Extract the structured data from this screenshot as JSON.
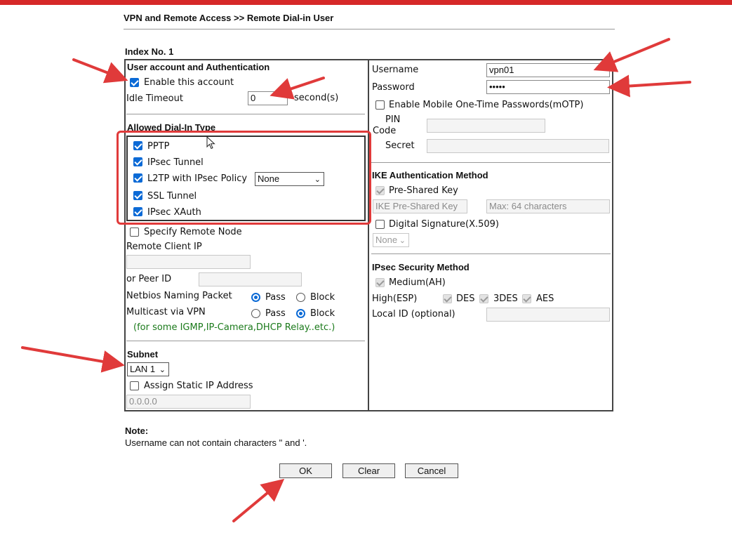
{
  "page": {
    "title": "VPN and Remote Access >> Remote Dial-in User",
    "index": "Index No. 1"
  },
  "left": {
    "section_title": "User account and Authentication",
    "enable_label": "Enable this account",
    "enable_checked": true,
    "idle_label": "Idle Timeout",
    "idle_value": "0",
    "idle_unit": "second(s)",
    "dialin_title": "Allowed Dial-In Type",
    "dialin_types": [
      {
        "label": "PPTP",
        "checked": true
      },
      {
        "label": "IPsec Tunnel",
        "checked": true
      },
      {
        "label": "L2TP with IPsec Policy",
        "checked": true
      },
      {
        "label": "SSL Tunnel",
        "checked": true
      },
      {
        "label": "IPsec XAuth",
        "checked": true
      }
    ],
    "l2tp_policy": "None",
    "specify_remote_label": "Specify Remote Node",
    "remote_client_ip_label": "Remote Client IP",
    "peer_id_label": "or Peer ID",
    "netbios_label": "Netbios Naming Packet",
    "multicast_label": "Multicast via VPN",
    "pass_label": "Pass",
    "block_label": "Block",
    "netbios_value": "Pass",
    "multicast_value": "Block",
    "multicast_note": "(for some IGMP,IP-Camera,DHCP Relay..etc.)",
    "subnet_title": "Subnet",
    "subnet_value": "LAN 1",
    "assign_static_label": "Assign Static IP Address",
    "static_ip_value": "0.0.0.0"
  },
  "right": {
    "username_label": "Username",
    "username_value": "vpn01",
    "password_label": "Password",
    "password_value": "•••••",
    "motp_label": "Enable Mobile One-Time Passwords(mOTP)",
    "pin_label_1": "PIN",
    "pin_label_2": "Code",
    "secret_label": "Secret",
    "ike_title": "IKE Authentication Method",
    "preshared_label": "Pre-Shared Key",
    "ike_key_placeholder": "IKE Pre-Shared Key",
    "max_chars_placeholder": "Max: 64 characters",
    "digital_sig_label": "Digital Signature(X.509)",
    "digital_sig_value": "None",
    "ipsec_title": "IPsec Security Method",
    "medium_label": "Medium(AH)",
    "high_label": "High(ESP)",
    "des_label": "DES",
    "tdes_label": "3DES",
    "aes_label": "AES",
    "local_id_label": "Local ID (optional)"
  },
  "note": {
    "title": "Note:",
    "text": "Username can not contain characters \" and '."
  },
  "buttons": {
    "ok": "OK",
    "clear": "Clear",
    "cancel": "Cancel"
  },
  "colors": {
    "accent": "#0b6ad6",
    "annotation_red": "#e03a3a",
    "note_green": "#1b7a1b"
  }
}
